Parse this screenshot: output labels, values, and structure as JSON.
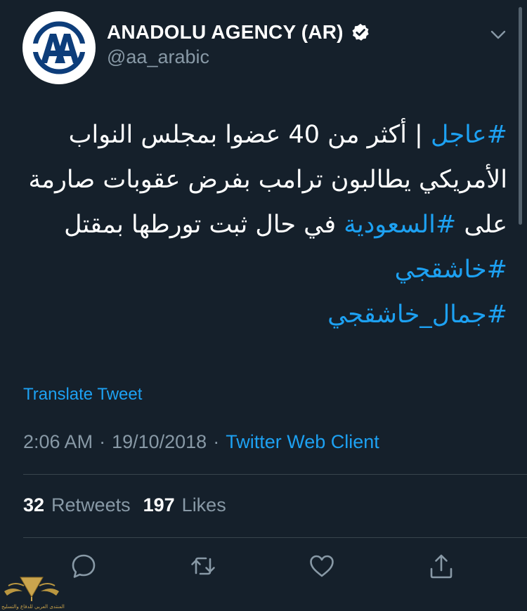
{
  "account": {
    "display_name": "ANADOLU AGENCY (AR)",
    "handle": "@aa_arabic",
    "avatar_logo": "AA",
    "verified": true
  },
  "tweet": {
    "line1": {
      "hashtag": "#عاجل",
      "text": " | أكثر من 40 عضوا بمجلس النواب"
    },
    "line2": {
      "text": "الأمريكي يطالبون ترامب بفرض عقوبات صارمة"
    },
    "line3": {
      "before": "على ",
      "hashtag": "#السعودية",
      "after": " في حال ثبت تورطها بمقتل"
    },
    "line4": {
      "hashtag": "#خاشقجي"
    },
    "line5": {
      "hashtag": "#جمال_خاشقجي"
    }
  },
  "translate_label": "Translate Tweet",
  "meta": {
    "time": "2:06 AM",
    "separator": "·",
    "date": "19/10/2018",
    "source": "Twitter Web Client"
  },
  "stats": {
    "retweets_count": "32",
    "retweets_label": "Retweets",
    "likes_count": "197",
    "likes_label": "Likes"
  },
  "actions": {
    "reply_icon": "reply-icon",
    "retweet_icon": "retweet-icon",
    "like_icon": "heart-icon",
    "share_icon": "share-icon"
  },
  "watermark": {
    "text": "المنتدى العربي للدفاع والتسليح"
  },
  "colors": {
    "background": "#15202b",
    "accent": "#1da1f2",
    "secondary_text": "#8899a6",
    "divider": "#38444d"
  }
}
